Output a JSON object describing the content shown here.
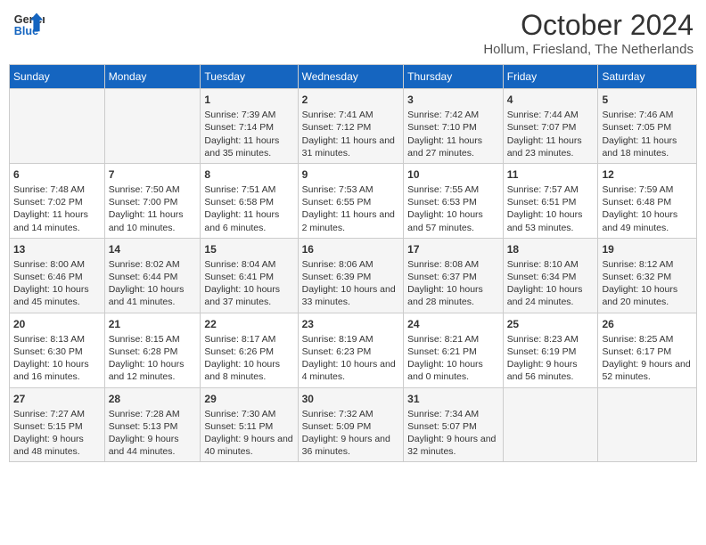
{
  "header": {
    "logo_line1": "General",
    "logo_line2": "Blue",
    "month": "October 2024",
    "location": "Hollum, Friesland, The Netherlands"
  },
  "weekdays": [
    "Sunday",
    "Monday",
    "Tuesday",
    "Wednesday",
    "Thursday",
    "Friday",
    "Saturday"
  ],
  "weeks": [
    [
      {
        "day": "",
        "info": ""
      },
      {
        "day": "",
        "info": ""
      },
      {
        "day": "1",
        "info": "Sunrise: 7:39 AM\nSunset: 7:14 PM\nDaylight: 11 hours and 35 minutes."
      },
      {
        "day": "2",
        "info": "Sunrise: 7:41 AM\nSunset: 7:12 PM\nDaylight: 11 hours and 31 minutes."
      },
      {
        "day": "3",
        "info": "Sunrise: 7:42 AM\nSunset: 7:10 PM\nDaylight: 11 hours and 27 minutes."
      },
      {
        "day": "4",
        "info": "Sunrise: 7:44 AM\nSunset: 7:07 PM\nDaylight: 11 hours and 23 minutes."
      },
      {
        "day": "5",
        "info": "Sunrise: 7:46 AM\nSunset: 7:05 PM\nDaylight: 11 hours and 18 minutes."
      }
    ],
    [
      {
        "day": "6",
        "info": "Sunrise: 7:48 AM\nSunset: 7:02 PM\nDaylight: 11 hours and 14 minutes."
      },
      {
        "day": "7",
        "info": "Sunrise: 7:50 AM\nSunset: 7:00 PM\nDaylight: 11 hours and 10 minutes."
      },
      {
        "day": "8",
        "info": "Sunrise: 7:51 AM\nSunset: 6:58 PM\nDaylight: 11 hours and 6 minutes."
      },
      {
        "day": "9",
        "info": "Sunrise: 7:53 AM\nSunset: 6:55 PM\nDaylight: 11 hours and 2 minutes."
      },
      {
        "day": "10",
        "info": "Sunrise: 7:55 AM\nSunset: 6:53 PM\nDaylight: 10 hours and 57 minutes."
      },
      {
        "day": "11",
        "info": "Sunrise: 7:57 AM\nSunset: 6:51 PM\nDaylight: 10 hours and 53 minutes."
      },
      {
        "day": "12",
        "info": "Sunrise: 7:59 AM\nSunset: 6:48 PM\nDaylight: 10 hours and 49 minutes."
      }
    ],
    [
      {
        "day": "13",
        "info": "Sunrise: 8:00 AM\nSunset: 6:46 PM\nDaylight: 10 hours and 45 minutes."
      },
      {
        "day": "14",
        "info": "Sunrise: 8:02 AM\nSunset: 6:44 PM\nDaylight: 10 hours and 41 minutes."
      },
      {
        "day": "15",
        "info": "Sunrise: 8:04 AM\nSunset: 6:41 PM\nDaylight: 10 hours and 37 minutes."
      },
      {
        "day": "16",
        "info": "Sunrise: 8:06 AM\nSunset: 6:39 PM\nDaylight: 10 hours and 33 minutes."
      },
      {
        "day": "17",
        "info": "Sunrise: 8:08 AM\nSunset: 6:37 PM\nDaylight: 10 hours and 28 minutes."
      },
      {
        "day": "18",
        "info": "Sunrise: 8:10 AM\nSunset: 6:34 PM\nDaylight: 10 hours and 24 minutes."
      },
      {
        "day": "19",
        "info": "Sunrise: 8:12 AM\nSunset: 6:32 PM\nDaylight: 10 hours and 20 minutes."
      }
    ],
    [
      {
        "day": "20",
        "info": "Sunrise: 8:13 AM\nSunset: 6:30 PM\nDaylight: 10 hours and 16 minutes."
      },
      {
        "day": "21",
        "info": "Sunrise: 8:15 AM\nSunset: 6:28 PM\nDaylight: 10 hours and 12 minutes."
      },
      {
        "day": "22",
        "info": "Sunrise: 8:17 AM\nSunset: 6:26 PM\nDaylight: 10 hours and 8 minutes."
      },
      {
        "day": "23",
        "info": "Sunrise: 8:19 AM\nSunset: 6:23 PM\nDaylight: 10 hours and 4 minutes."
      },
      {
        "day": "24",
        "info": "Sunrise: 8:21 AM\nSunset: 6:21 PM\nDaylight: 10 hours and 0 minutes."
      },
      {
        "day": "25",
        "info": "Sunrise: 8:23 AM\nSunset: 6:19 PM\nDaylight: 9 hours and 56 minutes."
      },
      {
        "day": "26",
        "info": "Sunrise: 8:25 AM\nSunset: 6:17 PM\nDaylight: 9 hours and 52 minutes."
      }
    ],
    [
      {
        "day": "27",
        "info": "Sunrise: 7:27 AM\nSunset: 5:15 PM\nDaylight: 9 hours and 48 minutes."
      },
      {
        "day": "28",
        "info": "Sunrise: 7:28 AM\nSunset: 5:13 PM\nDaylight: 9 hours and 44 minutes."
      },
      {
        "day": "29",
        "info": "Sunrise: 7:30 AM\nSunset: 5:11 PM\nDaylight: 9 hours and 40 minutes."
      },
      {
        "day": "30",
        "info": "Sunrise: 7:32 AM\nSunset: 5:09 PM\nDaylight: 9 hours and 36 minutes."
      },
      {
        "day": "31",
        "info": "Sunrise: 7:34 AM\nSunset: 5:07 PM\nDaylight: 9 hours and 32 minutes."
      },
      {
        "day": "",
        "info": ""
      },
      {
        "day": "",
        "info": ""
      }
    ]
  ]
}
